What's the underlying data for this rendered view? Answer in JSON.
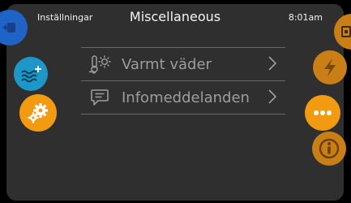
{
  "header": {
    "section_label": "Inställningar",
    "title": "Miscellaneous",
    "time": "8:01am"
  },
  "menu": {
    "items": [
      {
        "label": "Varmt väder",
        "icon": "warm-weather-icon"
      },
      {
        "label": "Infomeddelanden",
        "icon": "message-icon"
      }
    ]
  },
  "left_nav": [
    {
      "icon": "back-icon",
      "color": "#1f63c6"
    },
    {
      "icon": "water-heat-icon",
      "color": "#1c97c7"
    },
    {
      "icon": "gears-icon",
      "color": "#f29a10"
    }
  ],
  "right_nav": [
    {
      "icon": "power-icon",
      "color": "#c97e16"
    },
    {
      "icon": "lightning-icon",
      "color": "#c97e16"
    },
    {
      "icon": "more-icon",
      "color": "#f29a10"
    },
    {
      "icon": "info-icon",
      "color": "#c97e16"
    }
  ]
}
